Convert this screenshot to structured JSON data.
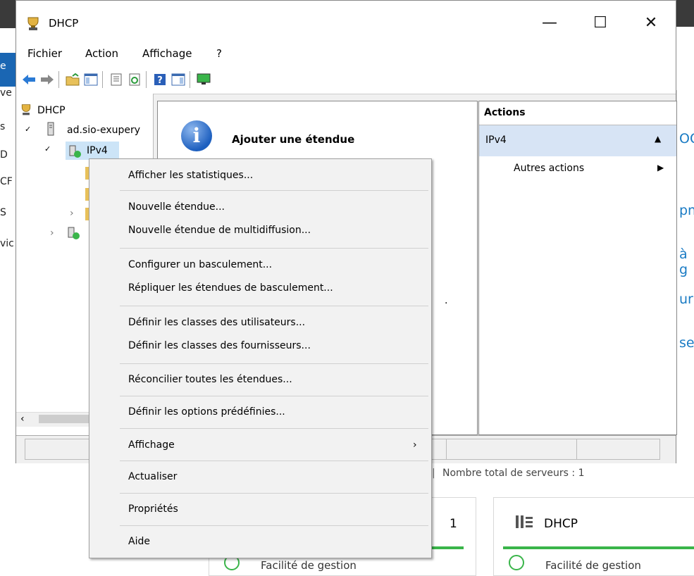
{
  "window": {
    "title": "DHCP",
    "minimize_glyph": "—",
    "maximize_glyph": "☐",
    "close_glyph": "✕"
  },
  "menu": [
    "Fichier",
    "Action",
    "Affichage",
    "?"
  ],
  "toolbar_icons": [
    "back-arrow-icon",
    "forward-arrow-icon",
    "up-folder-icon",
    "show-tree-icon",
    "properties-icon",
    "refresh-icon",
    "help-icon",
    "show-action-pane-icon",
    "monitor-icon"
  ],
  "tree": {
    "root": "DHCP",
    "server": "ad.sio-exupery",
    "ipv4": "IPv4"
  },
  "center": {
    "title": "Ajouter une étendue",
    "dot": "."
  },
  "actions": {
    "header": "Actions",
    "section": "IPv4",
    "more": "Autres actions"
  },
  "context_menu": {
    "items": [
      "Afficher les statistiques...",
      "Nouvelle étendue...",
      "Nouvelle étendue de multidiffusion...",
      "Configurer un basculement...",
      "Répliquer les étendues de basculement...",
      "Définir les classes des utilisateurs...",
      "Définir les classes des fournisseurs...",
      "Réconcilier toutes les étendues...",
      "Définir les options prédéfinies...",
      "Affichage",
      "Actualiser",
      "Propriétés",
      "Aide"
    ],
    "submenu_glyph": "›"
  },
  "background": {
    "left_fragments": [
      "e",
      "ve",
      "s",
      "D",
      "CF",
      "S",
      "vic"
    ],
    "right_fragments": [
      "OO",
      "pnd",
      "à g",
      "ur",
      "se"
    ],
    "servers_total": "Nombre total de serveurs : 1",
    "separator": "|",
    "tile1_count": "1",
    "tile2_title": "DHCP",
    "tile_bottom_text": "Facilité de gestion"
  }
}
